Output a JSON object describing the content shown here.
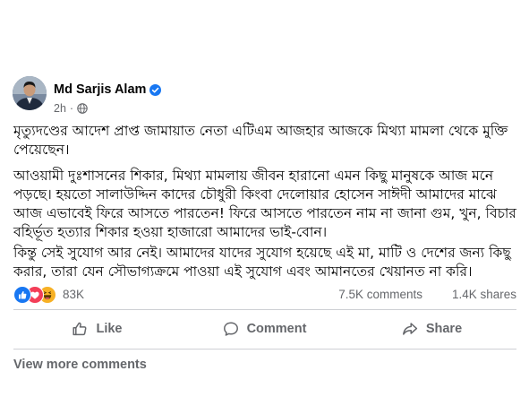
{
  "post": {
    "author": "Md Sarjis Alam",
    "time": "2h",
    "separator": "·",
    "paragraphs": [
      "মৃত্যুদণ্ডের আদেশ প্রাপ্ত জামায়াত নেতা এটিএম আজহার আজকে মিথ্যা মামলা থেকে মুক্তি পেয়েছেন।",
      "আওয়ামী দুঃশাসনের শিকার, মিথ্যা মামলায় জীবন হারানো এমন কিছু মানুষকে আজ মনে পড়ছে। হয়তো সালাউদ্দিন কাদের চৌধুরী কিংবা দেলোয়ার হোসেন সাঈদী আমাদের মাঝে আজ এভাবেই ফিরে আসতে পারতেন! ফিরে আসতে পারতেন নাম না জানা গুম, খুন, বিচার বহির্ভূত হত্যার শিকার হওয়া হাজারো আমাদের ভাই-বোন।",
      "কিন্তু সেই সুযোগ আর নেই। আমাদের যাদের সুযোগ হয়েছে এই মা, মাটি ও দেশের জন্য কিছু করার, তারা যেন সৌভাগ্যক্রমে পাওয়া এই সুযোগ এবং আমানতের খেয়ানত না করি।"
    ]
  },
  "stats": {
    "reactions": "83K",
    "comments": "7.5K comments",
    "shares": "1.4K shares",
    "reaction_icons": [
      "like-icon",
      "love-icon",
      "haha-icon"
    ]
  },
  "actions": {
    "like": "Like",
    "comment": "Comment",
    "share": "Share"
  },
  "view_more_comments": "View more comments",
  "colors": {
    "verified": "#1877f2",
    "like": "#1877f2",
    "love": "#f33e58",
    "haha": "#f7b125",
    "secondary_text": "#65676b",
    "divider": "#ced0d4"
  }
}
